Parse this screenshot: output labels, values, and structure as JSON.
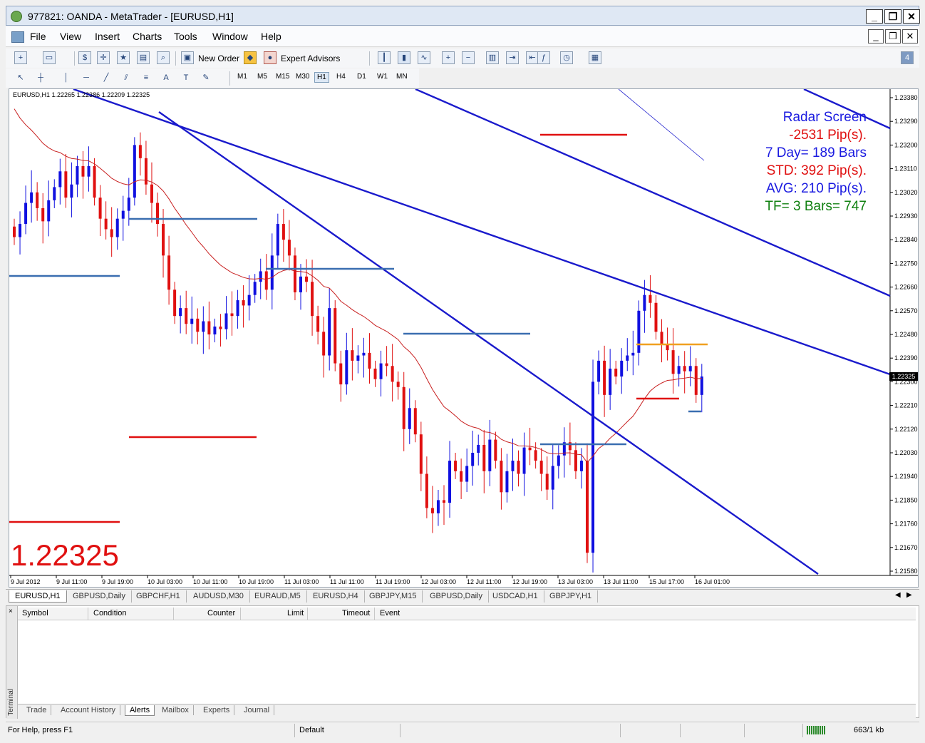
{
  "window": {
    "title": "977821: OANDA - MetaTrader - [EURUSD,H1]"
  },
  "menu": [
    "File",
    "View",
    "Insert",
    "Charts",
    "Tools",
    "Window",
    "Help"
  ],
  "toolbar": {
    "new_order": "New Order",
    "expert_advisors": "Expert Advisors"
  },
  "timeframes": [
    "M1",
    "M5",
    "M15",
    "M30",
    "H1",
    "H4",
    "D1",
    "W1",
    "MN"
  ],
  "active_timeframe": "H1",
  "chart": {
    "header": "EURUSD,H1  1.22265 1.22386 1.22209 1.22325",
    "big_price": "1.22325",
    "current_price": "1.22325",
    "radar": {
      "line1": "Radar Screen",
      "line2": "-2531 Pip(s).",
      "line3": "7 Day= 189 Bars",
      "line4": "STD: 392 Pip(s).",
      "line5": "AVG: 210 Pip(s).",
      "line6": "TF= 3 Bars= 747"
    },
    "colors": {
      "bull": "#1010e0",
      "bear": "#e01010",
      "trend": "#1a1acc",
      "level": "#3a6eb0",
      "ma": "#c82020",
      "orange": "#f0a020",
      "radar_blue": "#1a1ae0",
      "radar_red": "#e01010",
      "radar_green": "#108010"
    }
  },
  "chart_data": {
    "type": "candlestick",
    "title": "EURUSD,H1",
    "y_ticks": [
      "1.23380",
      "1.23290",
      "1.23200",
      "1.23110",
      "1.23020",
      "1.22930",
      "1.22840",
      "1.22750",
      "1.22660",
      "1.22570",
      "1.22480",
      "1.22390",
      "1.22300",
      "1.22210",
      "1.22120",
      "1.22030",
      "1.21940",
      "1.21850",
      "1.21760",
      "1.21670",
      "1.21580"
    ],
    "ylim": [
      1.2157,
      1.234
    ],
    "x_ticks": [
      "9 Jul 2012",
      "9 Jul 11:00",
      "9 Jul 19:00",
      "10 Jul 03:00",
      "10 Jul 11:00",
      "10 Jul 19:00",
      "11 Jul 03:00",
      "11 Jul 11:00",
      "11 Jul 19:00",
      "12 Jul 03:00",
      "12 Jul 11:00",
      "12 Jul 19:00",
      "13 Jul 03:00",
      "13 Jul 11:00",
      "15 Jul 17:00",
      "16 Jul 01:00"
    ],
    "close_path": [
      1.2285,
      1.229,
      1.2298,
      1.2302,
      1.2296,
      1.2291,
      1.2299,
      1.2304,
      1.231,
      1.23,
      1.2305,
      1.2312,
      1.2308,
      1.2312,
      1.23,
      1.2292,
      1.2288,
      1.2285,
      1.2292,
      1.2295,
      1.23,
      1.232,
      1.2315,
      1.2305,
      1.2298,
      1.229,
      1.2278,
      1.2265,
      1.2255,
      1.2258,
      1.2252,
      1.2254,
      1.2249,
      1.2253,
      1.2248,
      1.2251,
      1.225,
      1.2256,
      1.2255,
      1.2261,
      1.2259,
      1.2263,
      1.2268,
      1.2272,
      1.2265,
      1.2278,
      1.229,
      1.2284,
      1.2278,
      1.2264,
      1.227,
      1.2268,
      1.2255,
      1.2249,
      1.224,
      1.2258,
      1.2237,
      1.2229,
      1.2242,
      1.2238,
      1.224,
      1.2241,
      1.2235,
      1.2231,
      1.2237,
      1.2236,
      1.223,
      1.2228,
      1.2212,
      1.222,
      1.221,
      1.2195,
      1.2182,
      1.218,
      1.2185,
      1.2184,
      1.22,
      1.2196,
      1.2192,
      1.2198,
      1.2203,
      1.2206,
      1.2196,
      1.2208,
      1.22,
      1.2188,
      1.2196,
      1.22,
      1.2195,
      1.2205,
      1.2204,
      1.22,
      1.2195,
      1.2189,
      1.2198,
      1.2202,
      1.2207,
      1.2204,
      1.2196,
      1.22,
      1.2165,
      1.223,
      1.2238,
      1.2225,
      1.2235,
      1.2232,
      1.2238,
      1.224,
      1.2241,
      1.2257,
      1.2263,
      1.226,
      1.2249,
      1.2244,
      1.2242,
      1.2233,
      1.2236,
      1.2234,
      1.2236,
      1.2225,
      1.2232
    ]
  },
  "chart_tabs": [
    "EURUSD,H1",
    "GBPUSD,Daily",
    "GBPCHF,H1",
    "AUDUSD,M30",
    "EURAUD,M5",
    "EURUSD,H4",
    "GBPJPY,M15",
    "GBPUSD,Daily",
    "USDCAD,H1",
    "GBPJPY,H1"
  ],
  "terminal": {
    "label": "Terminal",
    "columns": [
      "Symbol",
      "Condition",
      "Counter",
      "Limit",
      "Timeout",
      "Event"
    ],
    "tabs": [
      "Trade",
      "Account History",
      "Alerts",
      "Mailbox",
      "Experts",
      "Journal"
    ],
    "active_tab": "Alerts"
  },
  "status": {
    "help": "For Help, press F1",
    "profile": "Default",
    "traffic": "663/1 kb"
  }
}
